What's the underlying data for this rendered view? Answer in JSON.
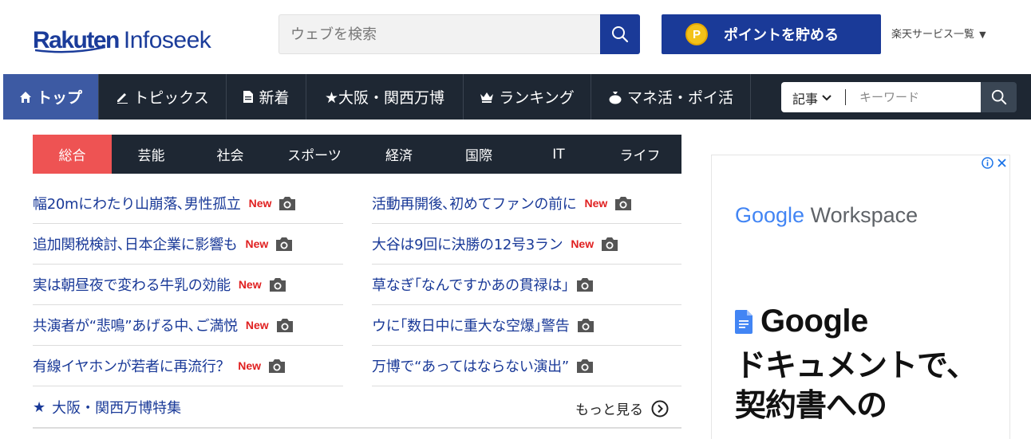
{
  "header": {
    "logo_brand": "Rakuten",
    "logo_product": "Infoseek",
    "search_placeholder": "ウェブを検索",
    "points_label": "ポイントを貯める",
    "coin_letter": "P",
    "services_label": "楽天サービス一覧"
  },
  "nav": {
    "items": [
      {
        "label": "トップ",
        "icon": "home-icon"
      },
      {
        "label": "トピックス",
        "icon": "pencil-icon"
      },
      {
        "label": "新着",
        "icon": "document-icon"
      },
      {
        "label": "★大阪・関西万博",
        "icon": ""
      },
      {
        "label": "ランキング",
        "icon": "crown-icon"
      },
      {
        "label": "マネ活・ポイ活",
        "icon": "moneybag-icon"
      }
    ],
    "search_scope": "記事",
    "keyword_placeholder": "キーワード"
  },
  "categories": [
    "総合",
    "芸能",
    "社会",
    "スポーツ",
    "経済",
    "国際",
    "IT",
    "ライフ"
  ],
  "articles_left": [
    {
      "title": "幅20mにわたり山崩落､男性孤立",
      "new": "New"
    },
    {
      "title": "追加関税検討､日本企業に影響も",
      "new": "New"
    },
    {
      "title": "実は朝昼夜で変わる牛乳の効能",
      "new": "New"
    },
    {
      "title": "共演者が“悲鳴”あげる中､ご満悦",
      "new": "New"
    },
    {
      "title": "有線イヤホンが若者に再流行？",
      "new": "New"
    }
  ],
  "articles_right": [
    {
      "title": "活動再開後､初めてファンの前に",
      "new": "New"
    },
    {
      "title": "大谷は9回に決勝の12号3ラン",
      "new": "New"
    },
    {
      "title": "草なぎ｢なんですかあの貫禄は｣",
      "new": ""
    },
    {
      "title": "ウに｢数日中に重大な空爆｣警告",
      "new": ""
    },
    {
      "title": "万博で“あってはならない演出”",
      "new": ""
    }
  ],
  "special_link": "大阪・関西万博特集",
  "more_link": "もっと見る",
  "ad": {
    "brand_word": "Google",
    "product_word": "Workspace",
    "docs_label": "Google",
    "headline_line1": "ドキュメントで､",
    "headline_line2": "契約書への"
  },
  "colors": {
    "brand_blue": "#1a3a98",
    "nav_bg": "#1e2733",
    "active_tab": "#ee5353",
    "new_red": "#e02020"
  }
}
